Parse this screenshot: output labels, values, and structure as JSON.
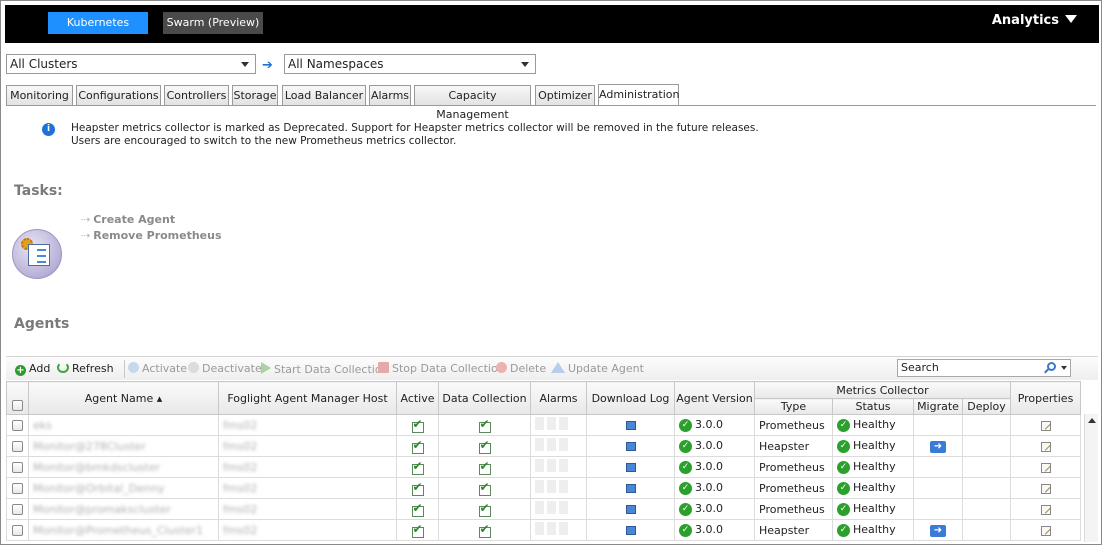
{
  "topbar": {
    "kubernetes_label": "Kubernetes",
    "swarm_label": "Swarm (Preview)",
    "analytics_label": "Analytics"
  },
  "filters": {
    "cluster": "All Clusters",
    "namespace": "All Namespaces"
  },
  "tabs": [
    "Monitoring",
    "Configurations",
    "Controllers",
    "Storage",
    "Load Balancer",
    "Alarms",
    "Capacity Management",
    "Optimizer",
    "Administration"
  ],
  "active_tab": "Administration",
  "info_message": "Heapster metrics collector is marked as Deprecated. Support for Heapster metrics collector will be removed in the future releases. Users are encouraged to switch to the new Prometheus metrics collector.",
  "tasks": {
    "title": "Tasks:",
    "items": [
      "Create Agent",
      "Remove Prometheus"
    ]
  },
  "agents": {
    "title": "Agents",
    "toolbar": {
      "add": "Add",
      "refresh": "Refresh",
      "activate": "Activate",
      "deactivate": "Deactivate",
      "start": "Start Data Collection",
      "stop": "Stop Data Collection",
      "delete": "Delete",
      "update": "Update Agent",
      "search_placeholder": "Search"
    },
    "columns": {
      "name": "Agent Name",
      "host": "Foglight Agent Manager Host",
      "active": "Active",
      "data_collection": "Data Collection",
      "alarms": "Alarms",
      "download_log": "Download Log",
      "version": "Agent Version",
      "metrics_collector": "Metrics Collector",
      "type": "Type",
      "status": "Status",
      "migrate": "Migrate",
      "deploy": "Deploy",
      "properties": "Properties"
    },
    "rows": [
      {
        "name": "eks",
        "host": "fms02",
        "version": "3.0.0",
        "type": "Prometheus",
        "status": "Healthy",
        "migrate": false
      },
      {
        "name": "Monitor@278Cluster",
        "host": "fms02",
        "version": "3.0.0",
        "type": "Heapster",
        "status": "Healthy",
        "migrate": true
      },
      {
        "name": "Monitor@bmkdscluster",
        "host": "fms02",
        "version": "3.0.0",
        "type": "Prometheus",
        "status": "Healthy",
        "migrate": false
      },
      {
        "name": "Monitor@Orbital_Denny",
        "host": "fms02",
        "version": "3.0.0",
        "type": "Prometheus",
        "status": "Healthy",
        "migrate": false
      },
      {
        "name": "Monitor@promakscluster",
        "host": "fms02",
        "version": "3.0.0",
        "type": "Prometheus",
        "status": "Healthy",
        "migrate": false
      },
      {
        "name": "Monitor@Prometheus_Cluster1",
        "host": "fms02",
        "version": "3.0.0",
        "type": "Heapster",
        "status": "Healthy",
        "migrate": true
      }
    ]
  }
}
